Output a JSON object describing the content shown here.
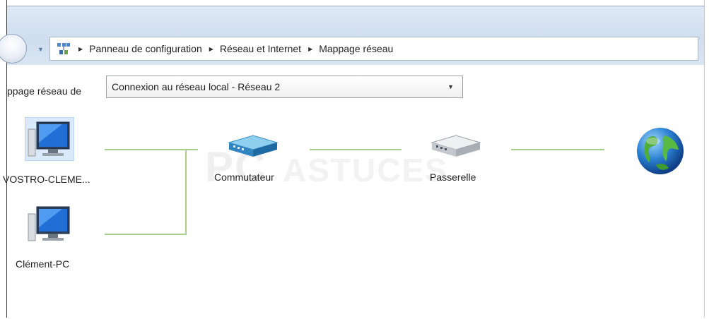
{
  "breadcrumb": {
    "items": [
      "Panneau de configuration",
      "Réseau et Internet",
      "Mappage réseau"
    ]
  },
  "toolbar": {
    "map_label": "ppage réseau de",
    "network_select": {
      "value": "Connexion au réseau local - Réseau  2"
    }
  },
  "network_map": {
    "nodes": {
      "pc1": {
        "label": "VOSTRO-CLEME..."
      },
      "pc2": {
        "label": "Clément-PC"
      },
      "switch": {
        "label": "Commutateur"
      },
      "gateway": {
        "label": "Passerelle"
      }
    },
    "link_color": "#a8cf8a",
    "selection_color": "#dbeafa"
  },
  "watermark": {
    "text": "PCASTUCES"
  }
}
